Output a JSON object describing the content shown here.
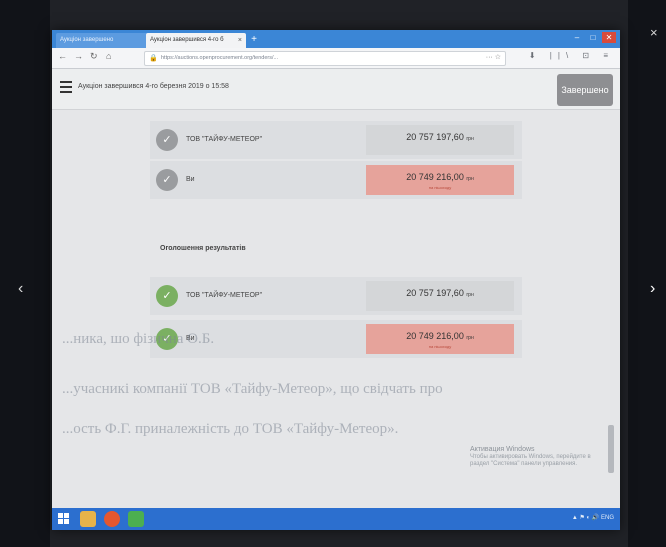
{
  "browser": {
    "tabs": [
      {
        "label": "Аукціон завершено"
      },
      {
        "label": "Аукціон завершився 4-го б"
      }
    ],
    "new_tab": "+",
    "window_buttons": [
      "–",
      "□",
      "✕"
    ],
    "nav": {
      "back": "←",
      "forward": "→",
      "reload": "↻",
      "home": "⌂"
    },
    "url": "https://auctions.openprocurement.org/tenders/...",
    "url_icons": "··· ☆",
    "toolbar_icons": "⬇ ||\\ ⊡ ≡"
  },
  "page": {
    "auction_status": "Аукціон завершився 4-го березня 2019 о 15:58",
    "finished_label": "Завершено",
    "bids_top": [
      {
        "name": "ТОВ \"ТАЙФУ-МЕТЕОР\"",
        "amount": "20 757 197,60",
        "currency": "грн",
        "note": "",
        "highlight": false
      },
      {
        "name": "Ви",
        "amount": "20 749 216,00",
        "currency": "грн",
        "note": "на пішоходу",
        "highlight": true
      }
    ],
    "results_title": "Оголошення результатів",
    "bids_results": [
      {
        "name": "ТОВ \"ТАЙФУ-МЕТЕОР\"",
        "amount": "20 757 197,60",
        "currency": "грн",
        "note": "",
        "highlight": false
      },
      {
        "name": "Ви",
        "amount": "20 749 216,00",
        "currency": "грн",
        "note": "на пішоходу",
        "highlight": true
      }
    ]
  },
  "overlay_document": {
    "line1": "...ника, шо фізична О.Б.",
    "line2": "...учасникі компанії ТОВ «Тайфу-Метеор», що свідчать про",
    "line3": "...ость Ф.Г. приналежність до ТОВ «Тайфу-Метеор»."
  },
  "windows_activation": {
    "title": "Активация Windows",
    "text": "Чтобы активировать Windows, перейдите в раздел \"Система\" панели управления."
  },
  "gallery": {
    "prev": "‹",
    "next": "›",
    "close": "×"
  },
  "colors": {
    "taskbar": "#2c6fcf",
    "highlight_bid": "#e6a39b",
    "finished_button": "#8e8f92",
    "check_green": "#7bb062"
  }
}
